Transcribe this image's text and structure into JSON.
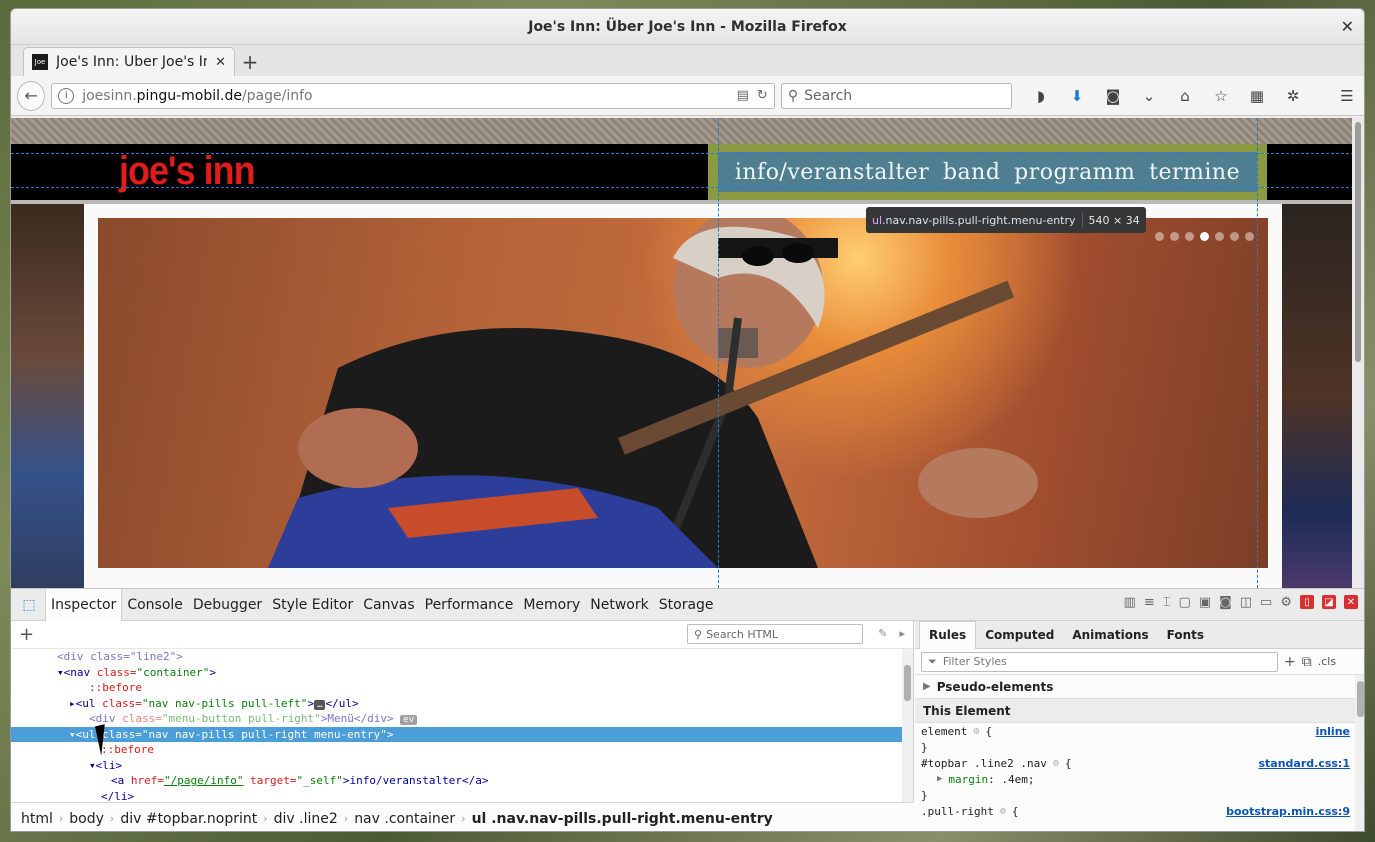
{
  "window": {
    "title": "Joe's Inn: Über Joe's Inn - Mozilla Firefox"
  },
  "tab": {
    "favicon": "Joe",
    "title": "Joe's Inn: Über Joe's Inn"
  },
  "navbar": {
    "url_prefix": "joesinn.",
    "url_host": "pingu-mobil.de",
    "url_path": "/page/info",
    "search_placeholder": "Search"
  },
  "page": {
    "brand": "joe's inn",
    "menu": [
      "info/veranstalter",
      "band",
      "programm",
      "termine"
    ],
    "slider_dots": 7,
    "slider_active": 4
  },
  "tooltip": {
    "tag": "ul",
    "selector": ".nav.nav-pills.pull-right.menu-entry",
    "dims": "540 × 34"
  },
  "devtools": {
    "tabs": [
      "Inspector",
      "Console",
      "Debugger",
      "Style Editor",
      "Canvas",
      "Performance",
      "Memory",
      "Network",
      "Storage"
    ],
    "search_html_placeholder": "Search HTML",
    "markup": {
      "l0": "<div class=\"line2\">",
      "l1_tag": "<nav",
      "l1_attr": " class=",
      "l1_val": "\"container\"",
      "l1_end": ">",
      "l2": "::before",
      "l3_tag": "<ul",
      "l3_attr": " class=",
      "l3_val": "\"nav nav-pills pull-left\"",
      "l3_end": ">",
      "l3_ell": "…",
      "l3_close": "</ul>",
      "l4_tag": "<div",
      "l4_attr": " class=",
      "l4_val": "\"menu-button pull-right\"",
      "l4_text": ">Menü</div>",
      "l4_ev": "ev",
      "l5_tag": "<ul",
      "l5_attr": " class=",
      "l5_val": "\"nav nav-pills pull-right menu-entry\"",
      "l5_end": ">",
      "l6": "::before",
      "l7": "<li>",
      "l8_tag": "<a",
      "l8_attr1": " href=",
      "l8_val1": "\"/page/info\"",
      "l8_attr2": " target=",
      "l8_val2": "\"_self\"",
      "l8_text": ">info/veranstalter</a>",
      "l9": "</li>"
    },
    "breadcrumbs": [
      "html",
      "body",
      "div #topbar.noprint",
      "div .line2",
      "nav .container",
      "ul .nav.nav-pills.pull-right.menu-entry"
    ],
    "rules_tabs": [
      "Rules",
      "Computed",
      "Animations",
      "Fonts"
    ],
    "filter_placeholder": "Filter Styles",
    "cls_label": ".cls",
    "sections": {
      "pseudo": "Pseudo-elements",
      "this_element": "This Element"
    },
    "rules": {
      "r1_sel": "element",
      "r1_src": "inline",
      "r2_sel": "#topbar .line2 .nav",
      "r2_src": "standard.css:1",
      "r2_prop": "margin",
      "r2_val": ".4em;",
      "r3_sel": ".pull-right",
      "r3_src": "bootstrap.min.css:9"
    }
  },
  "colors": {
    "brand_red": "#e21b1b",
    "menu_blue": "#4f7e90",
    "menu_olive": "#8b9a40",
    "selection": "#4c9ed9",
    "guide": "#1c7cd6"
  }
}
